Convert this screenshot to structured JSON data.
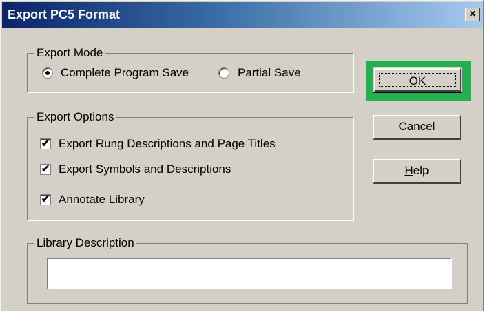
{
  "window": {
    "title": "Export PC5 Format",
    "close_glyph": "×"
  },
  "export_mode": {
    "legend": "Export Mode",
    "options": [
      {
        "label": "Complete Program Save",
        "selected": true
      },
      {
        "label": "Partial Save",
        "selected": false
      }
    ]
  },
  "export_options": {
    "legend": "Export Options",
    "items": [
      {
        "label": "Export Rung Descriptions and Page Titles",
        "checked": true
      },
      {
        "label": "Export Symbols and Descriptions",
        "checked": true
      },
      {
        "label": "Annotate Library",
        "checked": true
      }
    ]
  },
  "library_description": {
    "legend": "Library Description",
    "value": ""
  },
  "buttons": {
    "ok": "OK",
    "cancel": "Cancel",
    "help_prefix": "H",
    "help_rest": "elp"
  },
  "check_glyph": "✔",
  "colors": {
    "highlight": "#22b14c",
    "face": "#d4d0c8"
  }
}
